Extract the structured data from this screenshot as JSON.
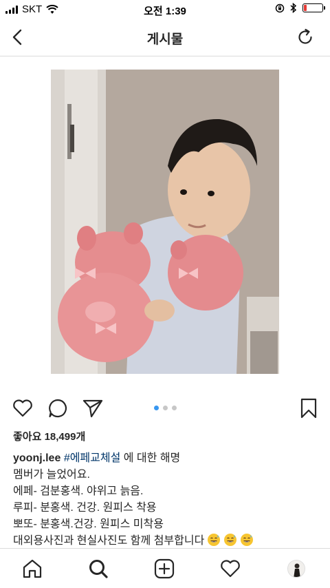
{
  "status_bar": {
    "carrier": "SKT",
    "time": "오전 1:39",
    "battery_level": 0.15,
    "battery_color": "#e53935"
  },
  "header": {
    "title": "게시물",
    "back_icon": "chevron-left-icon",
    "refresh_icon": "refresh-icon"
  },
  "post": {
    "image_description_icon": "photo",
    "carousel": {
      "count": 3,
      "active_index": 0
    },
    "actions": [
      "heart-icon",
      "comment-icon",
      "share-icon",
      "bookmark-icon"
    ],
    "likes_text": "좋아요 18,499개",
    "caption": {
      "username": "yoonj.lee",
      "hashtag": "#에페교체설",
      "title_rest": "에 대한 해명",
      "lines": [
        "멤버가 늘었어요.",
        "에페- 검분홍색. 야위고 늙음.",
        "루피- 분홍색. 건강. 원피스 착용",
        "뽀또- 분홍색.건강. 원피스 미착용",
        "대외용사진과 현실사진도 함께 첨부합니다"
      ],
      "emoji_count": 3
    }
  },
  "bottom_nav": {
    "items": [
      "home-icon",
      "search-icon",
      "add-icon",
      "activity-icon",
      "profile-avatar"
    ]
  },
  "colors": {
    "accent": "#3897f0",
    "hashtag": "#003569",
    "text": "#262626",
    "divider": "#dbdbdb"
  }
}
